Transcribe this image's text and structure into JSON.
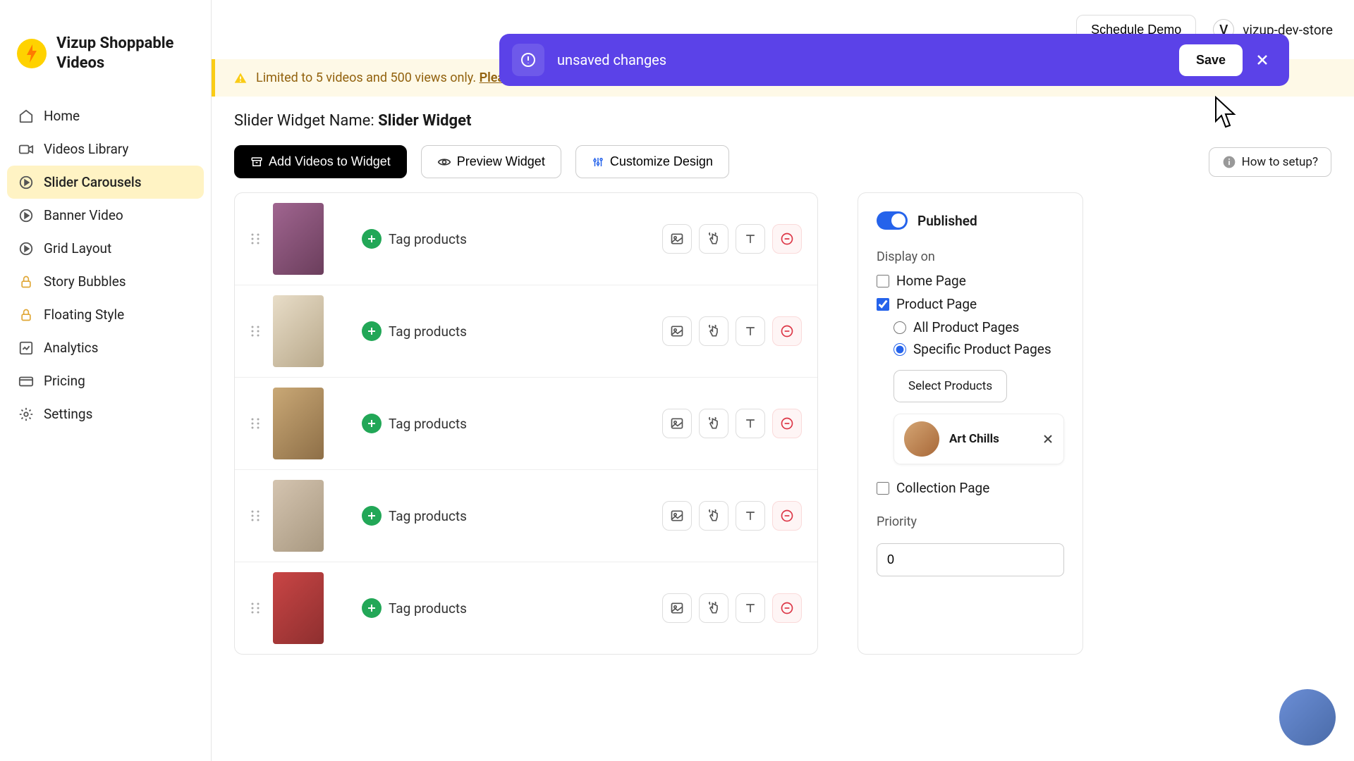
{
  "brand": {
    "title": "Vizup Shoppable Videos"
  },
  "nav": {
    "home": "Home",
    "videos_library": "Videos Library",
    "slider_carousels": "Slider Carousels",
    "banner_video": "Banner Video",
    "grid_layout": "Grid Layout",
    "story_bubbles": "Story Bubbles",
    "floating_style": "Floating Style",
    "analytics": "Analytics",
    "pricing": "Pricing",
    "settings": "Settings"
  },
  "topbar": {
    "schedule_demo": "Schedule Demo",
    "store_initial": "V",
    "store_name": "vizup-dev-store"
  },
  "banner": {
    "text": "unsaved changes",
    "save": "Save"
  },
  "warning": {
    "text": "Limited to 5 videos and 500 views only. ",
    "link": "Please select a paid plan here."
  },
  "widget": {
    "label": "Slider Widget Name: ",
    "name": "Slider Widget"
  },
  "actions": {
    "add": "Add Videos to Widget",
    "preview": "Preview Widget",
    "customize": "Customize Design",
    "help": "How to setup?"
  },
  "video_rows": {
    "tag_label": "Tag products"
  },
  "settings_panel": {
    "published": "Published",
    "display_on": "Display on",
    "home_page": "Home Page",
    "product_page": "Product Page",
    "all_product_pages": "All Product Pages",
    "specific_product_pages": "Specific Product Pages",
    "select_products": "Select Products",
    "selected_product": "Art Chills",
    "collection_page": "Collection Page",
    "priority": "Priority",
    "priority_value": "0"
  }
}
